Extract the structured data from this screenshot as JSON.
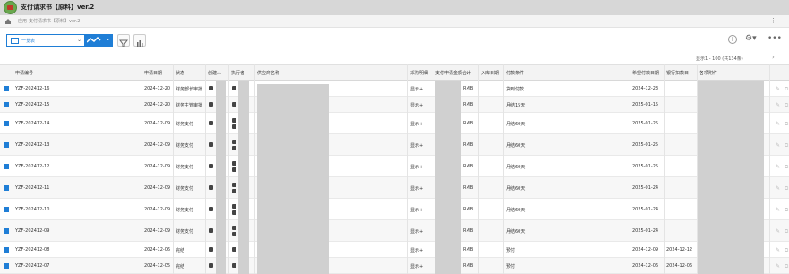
{
  "app": {
    "title": "支付请求书【原料】ver.2"
  },
  "breadcrumb": [
    "应用",
    "支付请求书【原料】ver.2"
  ],
  "toolbar": {
    "view_label": "一览表"
  },
  "pagination": {
    "text": "显示1 - 100  (共134条)"
  },
  "columns": [
    "申请编号",
    "申请日期",
    "状态",
    "创建人",
    "执行者",
    "供应商名称",
    "采购明细",
    "支付申请金额合计",
    "入库日期",
    "付款条件",
    "希望付款日期",
    "银行扣款日",
    "各项附件"
  ],
  "rows": [
    {
      "no": "YZF-202412-16",
      "date": "2024-12-20",
      "status": "财务部长审批",
      "detail": "显示+",
      "currency": "RMB",
      "term": "货到付款",
      "hope": "2024-12-23",
      "debit": "",
      "persons": 1
    },
    {
      "no": "YZF-202412-15",
      "date": "2024-12-20",
      "status": "财务主管审批",
      "detail": "显示+",
      "currency": "RMB",
      "term": "月结15天",
      "hope": "2025-01-15",
      "debit": "",
      "persons": 1
    },
    {
      "no": "YZF-202412-14",
      "date": "2024-12-09",
      "status": "财务支付",
      "detail": "显示+",
      "currency": "RMB",
      "term": "月结60天",
      "hope": "2025-01-25",
      "debit": "",
      "persons": 2
    },
    {
      "no": "YZF-202412-13",
      "date": "2024-12-09",
      "status": "财务支付",
      "detail": "显示+",
      "currency": "RMB",
      "term": "月结60天",
      "hope": "2025-01-25",
      "debit": "",
      "persons": 2
    },
    {
      "no": "YZF-202412-12",
      "date": "2024-12-09",
      "status": "财务支付",
      "detail": "显示+",
      "currency": "RMB",
      "term": "月结60天",
      "hope": "2025-01-25",
      "debit": "",
      "persons": 2
    },
    {
      "no": "YZF-202412-11",
      "date": "2024-12-09",
      "status": "财务支付",
      "detail": "显示+",
      "currency": "RMB",
      "term": "月结60天",
      "hope": "2025-01-24",
      "debit": "",
      "persons": 2
    },
    {
      "no": "YZF-202412-10",
      "date": "2024-12-09",
      "status": "财务支付",
      "detail": "显示+",
      "currency": "RMB",
      "term": "月结60天",
      "hope": "2025-01-24",
      "debit": "",
      "persons": 2
    },
    {
      "no": "YZF-202412-09",
      "date": "2024-12-09",
      "status": "财务支付",
      "detail": "显示+",
      "currency": "RMB",
      "term": "月结60天",
      "hope": "2025-01-24",
      "debit": "",
      "persons": 2
    },
    {
      "no": "YZF-202412-08",
      "date": "2024-12-06",
      "status": "完结",
      "detail": "显示+",
      "currency": "RMB",
      "term": "预付",
      "hope": "2024-12-09",
      "debit": "2024-12-12",
      "persons": 1
    },
    {
      "no": "YZF-202412-07",
      "date": "2024-12-05",
      "status": "完结",
      "detail": "显示+",
      "currency": "RMB",
      "term": "预付",
      "hope": "2024-12-06",
      "debit": "2024-12-06",
      "persons": 1
    }
  ]
}
